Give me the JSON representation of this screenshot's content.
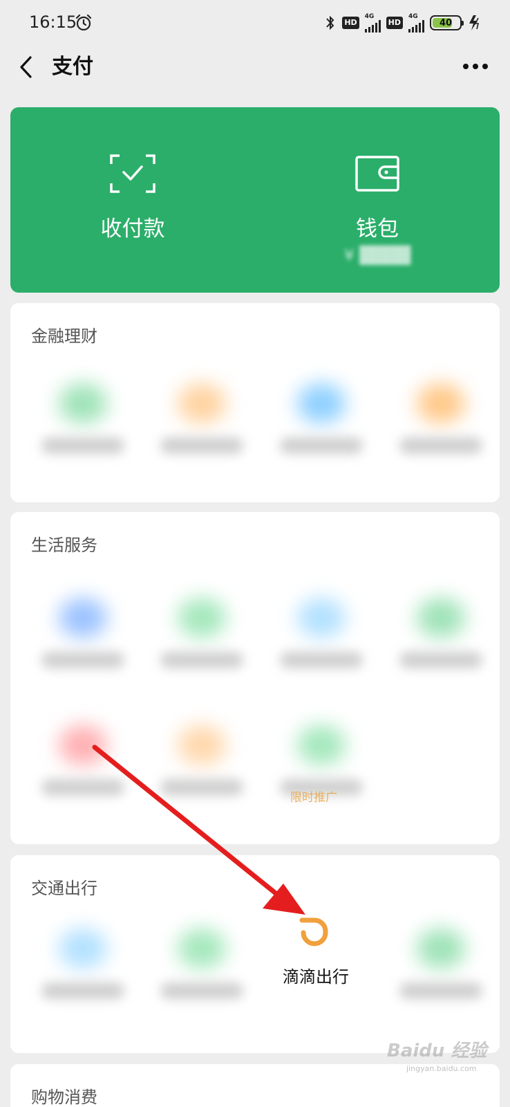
{
  "status_bar": {
    "time": "16:15",
    "hd_1": "HD",
    "hd_2": "HD",
    "net_1": "4G",
    "net_2": "4G",
    "battery": "40"
  },
  "nav": {
    "title": "支付"
  },
  "wallet_card": {
    "pay_label": "收付款",
    "wallet_label": "钱包",
    "balance_prefix": "¥"
  },
  "sections": [
    {
      "title": "金融理财"
    },
    {
      "title": "生活服务",
      "promo_tag": "限时推广"
    },
    {
      "title": "交通出行",
      "featured_item": "滴滴出行"
    },
    {
      "title": "购物消费"
    }
  ],
  "watermark": {
    "brand": "Baidu 经验",
    "url": "jingyan.baidu.com"
  },
  "colors": {
    "brand_green": "#2bae6a",
    "didi_orange": "#f0a03c",
    "annotation_red": "#e41e1e"
  }
}
